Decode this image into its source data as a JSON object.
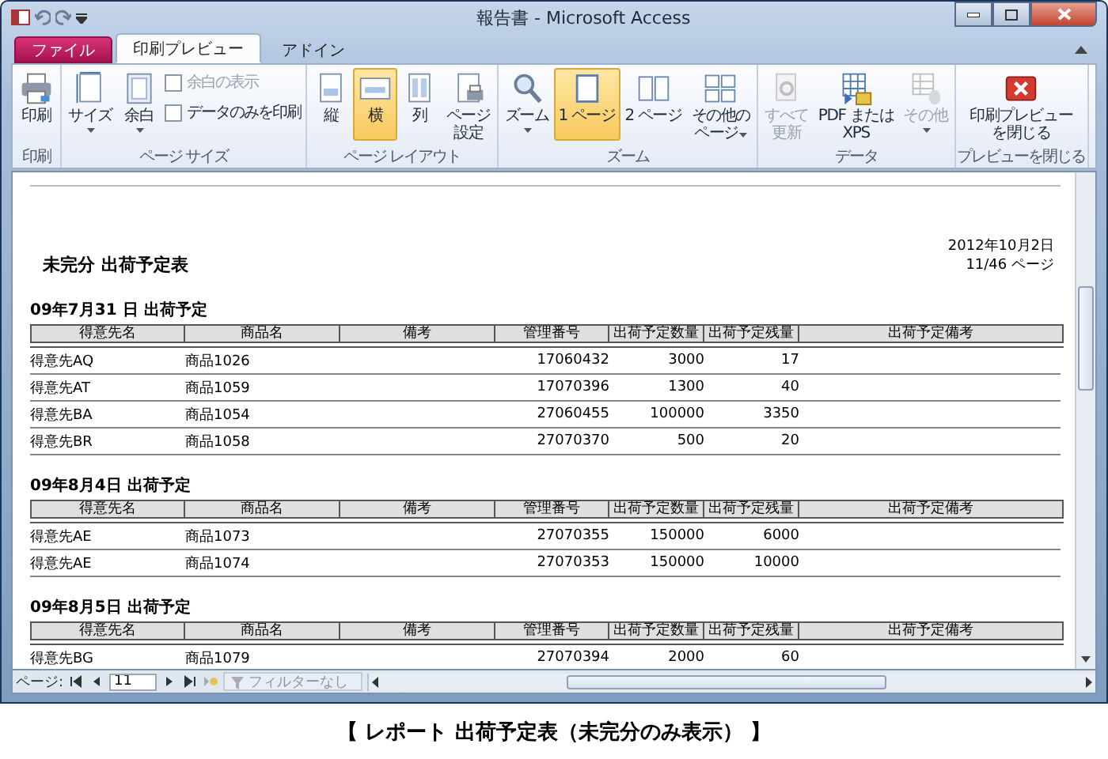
{
  "window": {
    "title": "報告書 - Microsoft Access"
  },
  "tabs": [
    {
      "label": "ファイル",
      "kind": "file",
      "selected": false
    },
    {
      "label": "印刷プレビュー",
      "kind": "normal",
      "selected": true
    },
    {
      "label": "アドイン",
      "kind": "normal",
      "selected": false
    }
  ],
  "ribbon": {
    "groups": [
      {
        "label": "印刷",
        "items": [
          {
            "kind": "large",
            "lines": [
              "印刷"
            ],
            "selected": false,
            "disabled": false,
            "dropdown": false
          }
        ]
      },
      {
        "label": "ページ サイズ",
        "items": [
          {
            "kind": "large",
            "lines": [
              "サイズ"
            ],
            "selected": false,
            "disabled": false,
            "dropdown": true
          },
          {
            "kind": "large",
            "lines": [
              "余白"
            ],
            "selected": false,
            "disabled": false,
            "dropdown": true
          },
          {
            "kind": "check",
            "label": "余白の表示",
            "checked": false,
            "disabled": true
          },
          {
            "kind": "check",
            "label": "データのみを印刷",
            "checked": false,
            "disabled": false
          }
        ]
      },
      {
        "label": "ページ レイアウト",
        "items": [
          {
            "kind": "large",
            "lines": [
              "縦"
            ],
            "selected": false,
            "disabled": false,
            "dropdown": false
          },
          {
            "kind": "large",
            "lines": [
              "横"
            ],
            "selected": true,
            "disabled": false,
            "dropdown": false
          },
          {
            "kind": "large",
            "lines": [
              "列"
            ],
            "selected": false,
            "disabled": false,
            "dropdown": false
          },
          {
            "kind": "large",
            "lines": [
              "ページ",
              "設定"
            ],
            "selected": false,
            "disabled": false,
            "dropdown": false
          }
        ]
      },
      {
        "label": "ズーム",
        "items": [
          {
            "kind": "large",
            "lines": [
              "ズーム"
            ],
            "selected": false,
            "disabled": false,
            "dropdown": true
          },
          {
            "kind": "large",
            "lines": [
              "1 ページ"
            ],
            "selected": true,
            "disabled": false,
            "dropdown": false
          },
          {
            "kind": "large",
            "lines": [
              "2 ページ"
            ],
            "selected": false,
            "disabled": false,
            "dropdown": false
          },
          {
            "kind": "large",
            "lines": [
              "その他の",
              "ページ"
            ],
            "selected": false,
            "disabled": false,
            "dropdown": true
          }
        ]
      },
      {
        "label": "データ",
        "items": [
          {
            "kind": "large",
            "lines": [
              "すべて",
              "更新"
            ],
            "selected": false,
            "disabled": true,
            "dropdown": false
          },
          {
            "kind": "large",
            "lines": [
              "PDF または",
              "XPS"
            ],
            "selected": false,
            "disabled": false,
            "dropdown": false
          },
          {
            "kind": "large",
            "lines": [
              "その他"
            ],
            "selected": false,
            "disabled": true,
            "dropdown": true
          }
        ]
      },
      {
        "label": "プレビューを閉じる",
        "items": [
          {
            "kind": "large",
            "lines": [
              "印刷プレビュー",
              "を閉じる"
            ],
            "selected": false,
            "disabled": false,
            "dropdown": false
          }
        ]
      }
    ]
  },
  "report": {
    "title": "未完分 出荷予定表",
    "date": "2012年10月2日",
    "page": "11/46 ページ",
    "sections": [
      {
        "heading": "09年7月31 日 出荷予定",
        "columns": [
          "得意先名",
          "商品名",
          "備考",
          "管理番号",
          "出荷予定数量",
          "出荷予定残量",
          "出荷予定備考"
        ],
        "rows": [
          {
            "customer": "得意先AQ",
            "product": "商品1026",
            "code": "17060432",
            "qty": "3000",
            "remaining": "17"
          },
          {
            "customer": "得意先AT",
            "product": "商品1059",
            "code": "17070396",
            "qty": "1300",
            "remaining": "40"
          },
          {
            "customer": "得意先BA",
            "product": "商品1054",
            "code": "27060455",
            "qty": "100000",
            "remaining": "3350"
          },
          {
            "customer": "得意先BR",
            "product": "商品1058",
            "code": "27070370",
            "qty": "500",
            "remaining": "20"
          }
        ]
      },
      {
        "heading": "09年8月4日 出荷予定",
        "columns": [
          "得意先名",
          "商品名",
          "備考",
          "管理番号",
          "出荷予定数量",
          "出荷予定残量",
          "出荷予定備考"
        ],
        "rows": [
          {
            "customer": "得意先AE",
            "product": "商品1073",
            "code": "27070355",
            "qty": "150000",
            "remaining": "6000"
          },
          {
            "customer": "得意先AE",
            "product": "商品1074",
            "code": "27070353",
            "qty": "150000",
            "remaining": "10000"
          }
        ]
      },
      {
        "heading": "09年8月5日 出荷予定",
        "columns": [
          "得意先名",
          "商品名",
          "備考",
          "管理番号",
          "出荷予定数量",
          "出荷予定残量",
          "出荷予定備考"
        ],
        "rows": [
          {
            "customer": "得意先BG",
            "product": "商品1079",
            "code": "27070394",
            "qty": "2000",
            "remaining": "60"
          }
        ]
      }
    ]
  },
  "navigation": {
    "label": "ページ:",
    "page": "11",
    "filter": "フィルターなし"
  },
  "caption": "【 レポート 出荷予定表（未完分のみ表示） 】"
}
